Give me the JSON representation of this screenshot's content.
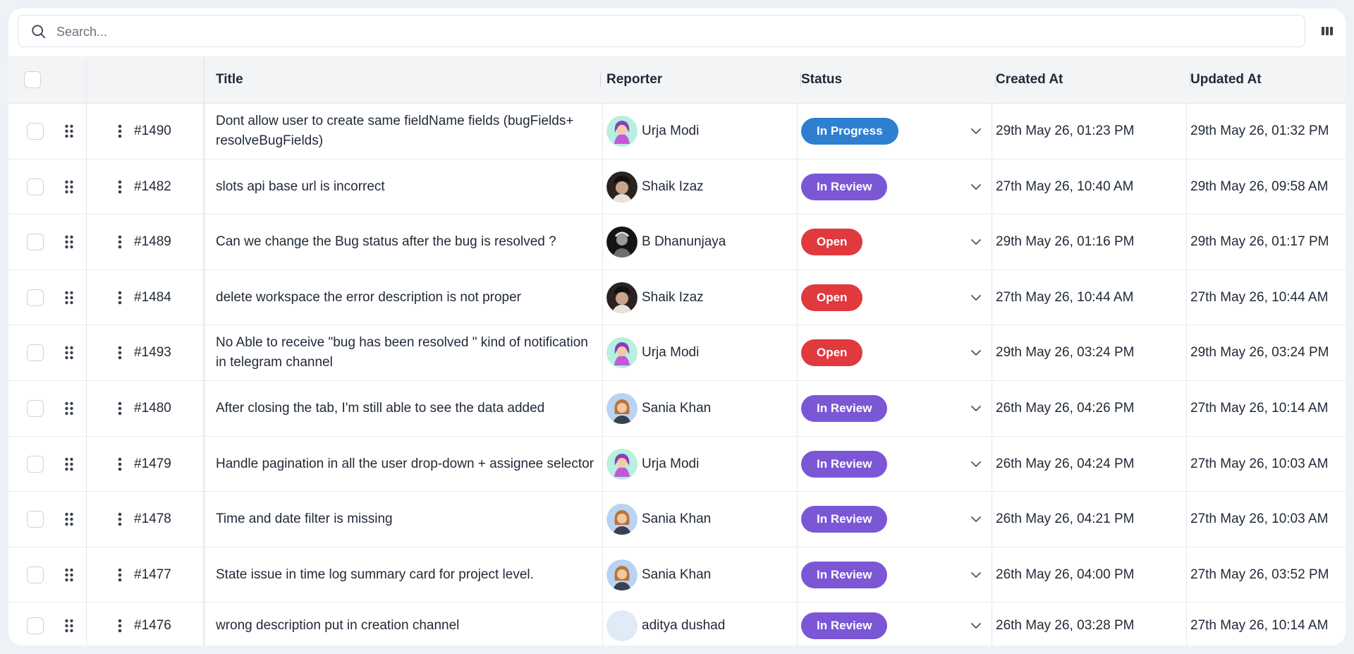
{
  "search": {
    "placeholder": "Search..."
  },
  "columns": {
    "title": "Title",
    "reporter": "Reporter",
    "status": "Status",
    "created": "Created At",
    "updated": "Updated At"
  },
  "status_colors": {
    "In Progress": "#2f7fd0",
    "In Review": "#7b57d6",
    "Open": "#e0393e"
  },
  "rows": [
    {
      "id": "#1490",
      "title": "Dont allow user to create same fieldName fields (bugFields+ resolveBugFields)",
      "reporter": "Urja Modi",
      "avatar": "urja",
      "status": "In Progress",
      "created": "29th May 26, 01:23 PM",
      "updated": "29th May 26, 01:32 PM"
    },
    {
      "id": "#1482",
      "title": "slots api base url is incorrect",
      "reporter": "Shaik Izaz",
      "avatar": "shaik",
      "status": "In Review",
      "created": "27th May 26, 10:40 AM",
      "updated": "29th May 26, 09:58 AM"
    },
    {
      "id": "#1489",
      "title": "Can we change the Bug status after the bug is resolved ?",
      "reporter": "B Dhanunjaya",
      "avatar": "dhanunjaya",
      "status": "Open",
      "created": "29th May 26, 01:16 PM",
      "updated": "29th May 26, 01:17 PM"
    },
    {
      "id": "#1484",
      "title": "delete workspace the error description is not proper",
      "reporter": "Shaik Izaz",
      "avatar": "shaik",
      "status": "Open",
      "created": "27th May 26, 10:44 AM",
      "updated": "27th May 26, 10:44 AM"
    },
    {
      "id": "#1493",
      "title": "No Able to receive \"bug has been resolved \" kind of notification in telegram channel",
      "reporter": "Urja Modi",
      "avatar": "urja",
      "status": "Open",
      "created": "29th May 26, 03:24 PM",
      "updated": "29th May 26, 03:24 PM"
    },
    {
      "id": "#1480",
      "title": "After closing the tab, I'm still able to see the data added",
      "reporter": "Sania Khan",
      "avatar": "sania",
      "status": "In Review",
      "created": "26th May 26, 04:26 PM",
      "updated": "27th May 26, 10:14 AM"
    },
    {
      "id": "#1479",
      "title": "Handle pagination in all the user drop-down + assignee selector",
      "reporter": "Urja Modi",
      "avatar": "urja",
      "status": "In Review",
      "created": "26th May 26, 04:24 PM",
      "updated": "27th May 26, 10:03 AM"
    },
    {
      "id": "#1478",
      "title": "Time and date filter is missing",
      "reporter": "Sania Khan",
      "avatar": "sania",
      "status": "In Review",
      "created": "26th May 26, 04:21 PM",
      "updated": "27th May 26, 10:03 AM"
    },
    {
      "id": "#1477",
      "title": "State issue in time log summary card for project level.",
      "reporter": "Sania Khan",
      "avatar": "sania",
      "status": "In Review",
      "created": "26th May 26, 04:00 PM",
      "updated": "27th May 26, 03:52 PM"
    },
    {
      "id": "#1476",
      "title": "wrong description put in creation channel",
      "reporter": "aditya dushad",
      "avatar": "blank",
      "status": "In Review",
      "created": "26th May 26, 03:28 PM",
      "updated": "27th May 26, 10:14 AM"
    }
  ]
}
